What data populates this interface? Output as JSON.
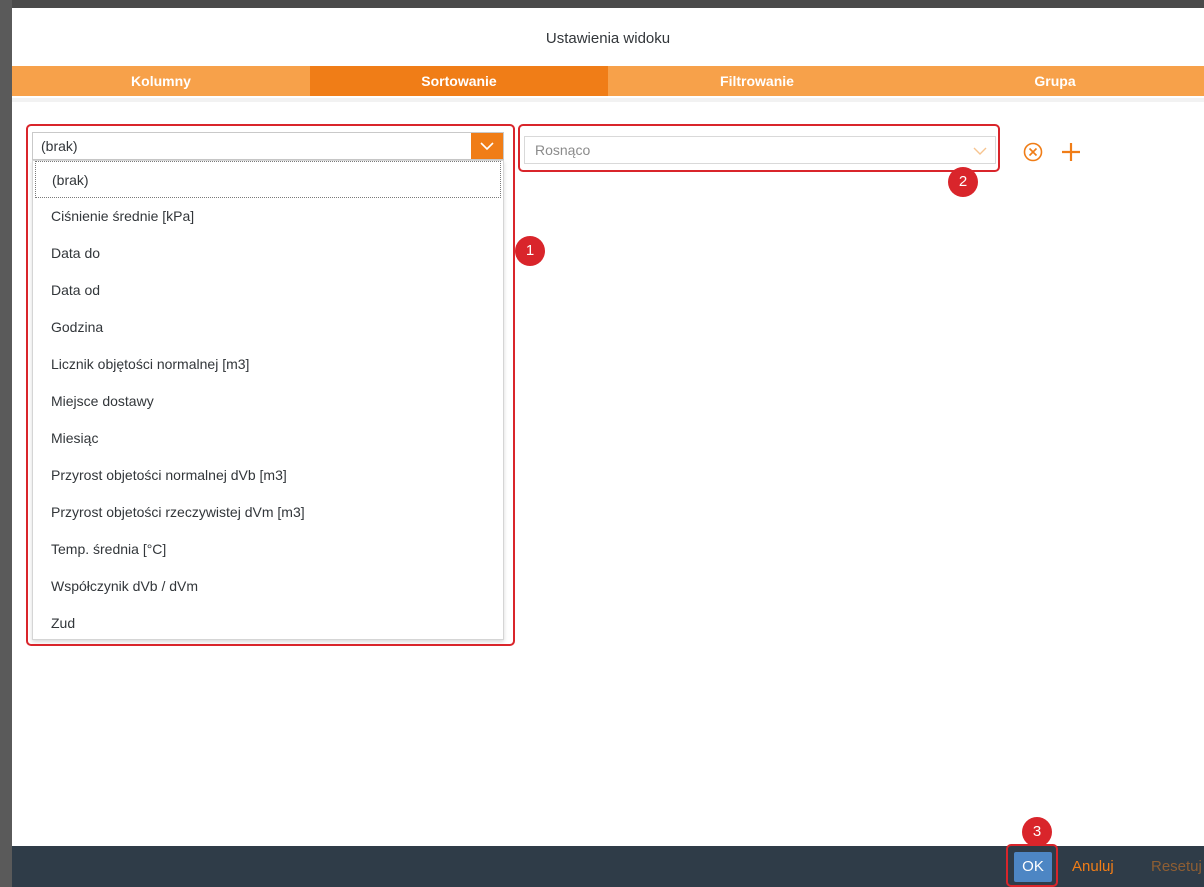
{
  "dialog": {
    "title": "Ustawienia widoku"
  },
  "tabs": [
    {
      "label": "Kolumny",
      "active": false
    },
    {
      "label": "Sortowanie",
      "active": true
    },
    {
      "label": "Filtrowanie",
      "active": false
    },
    {
      "label": "Grupa",
      "active": false
    }
  ],
  "sort": {
    "column_value": "(brak)",
    "order_value": "Rosnąco",
    "options": [
      "(brak)",
      "Ciśnienie średnie [kPa]",
      "Data do",
      "Data od",
      "Godzina",
      "Licznik objętości normalnej [m3]",
      "Miejsce dostawy",
      "Miesiąc",
      "Przyrost objetości normalnej dVb [m3]",
      "Przyrost objetości rzeczywistej dVm [m3]",
      "Temp. średnia [°C]",
      "Współczynik dVb / dVm",
      "Zud"
    ],
    "remove_icon": "circle-x-icon",
    "add_icon": "plus-icon"
  },
  "annotations": [
    "1",
    "2",
    "3"
  ],
  "footer": {
    "ok_label": "OK",
    "cancel_label": "Anuluj",
    "reset_label": "Resetuj"
  },
  "colors": {
    "accent": "#f07d17",
    "tab_bg": "#f7a14a",
    "footer_bg": "#2f3c48",
    "ok_bg": "#4d86c4",
    "annotation": "#d9252b"
  }
}
